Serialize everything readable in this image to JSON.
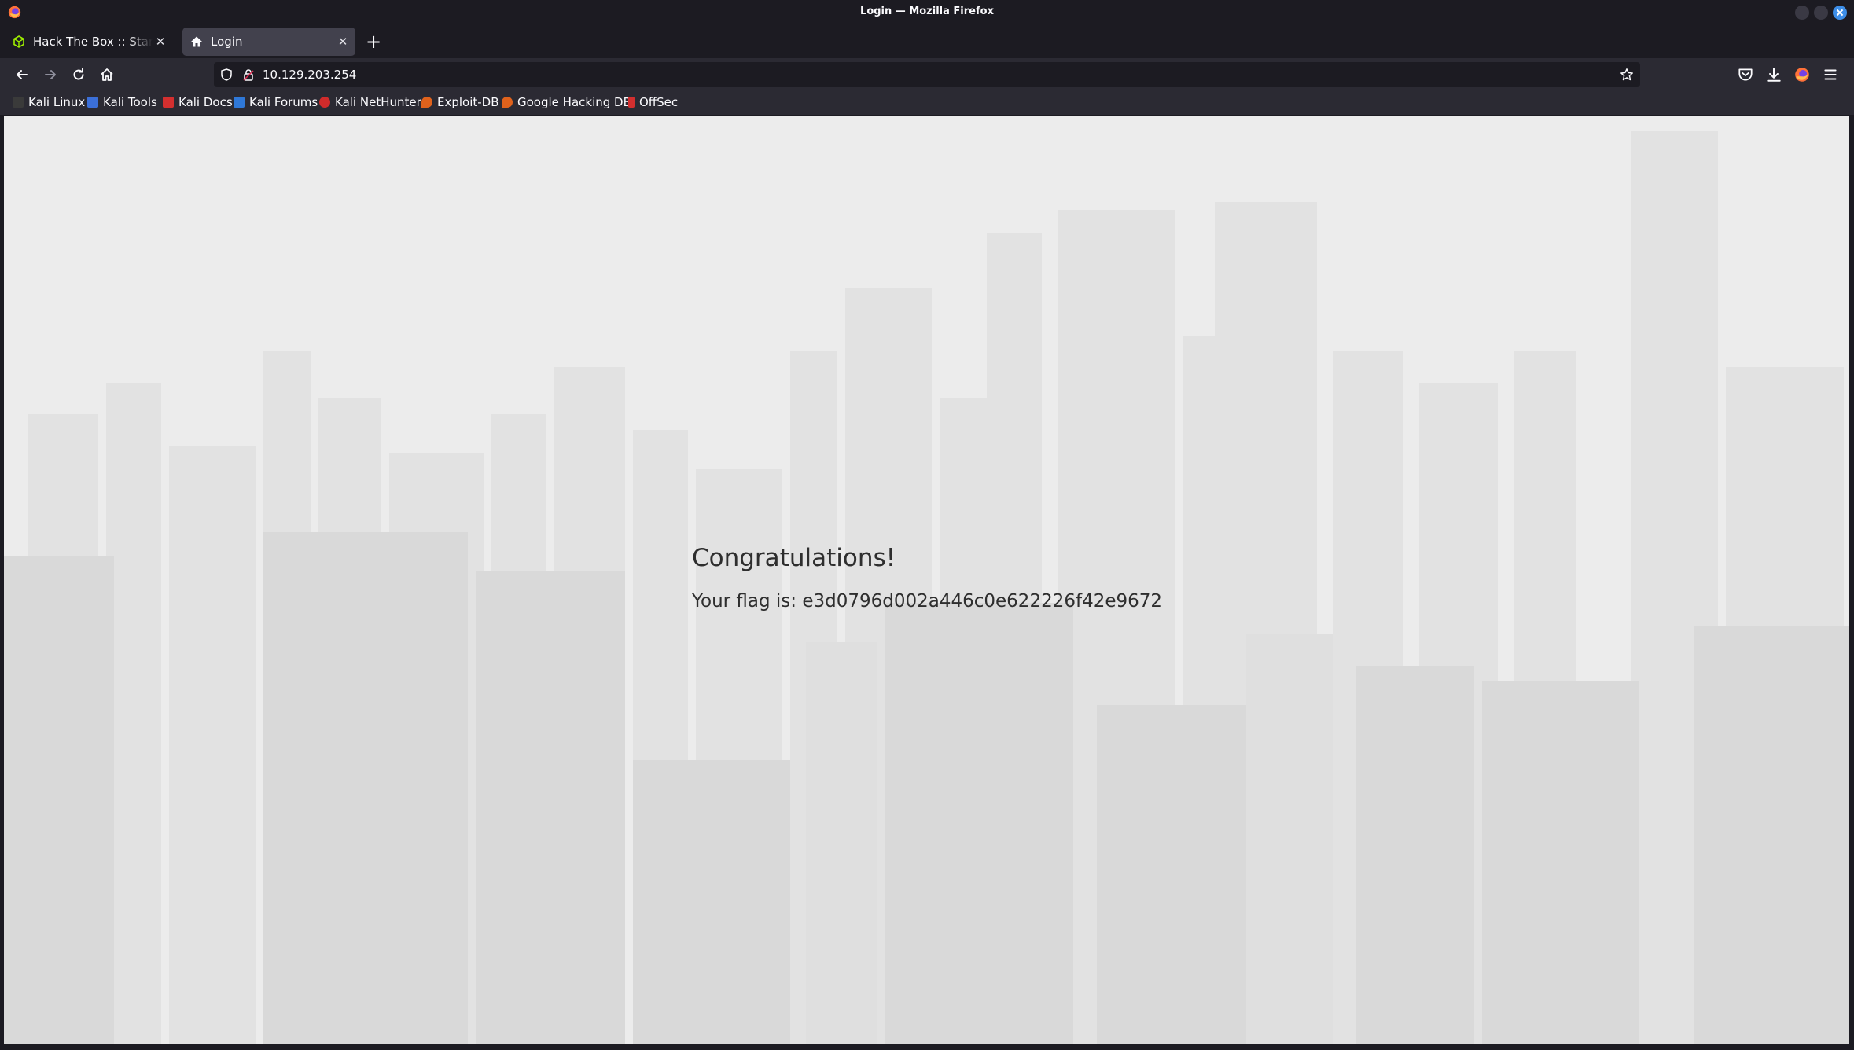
{
  "window": {
    "title": "Login — Mozilla Firefox"
  },
  "tabs": [
    {
      "label": "Hack The Box :: Starting P",
      "active": false,
      "favicon": "hackthebox-cube-icon"
    },
    {
      "label": "Login",
      "active": true,
      "favicon": "home-icon"
    }
  ],
  "navbar": {
    "url": "10.129.203.254"
  },
  "bookmarks": [
    {
      "label": "Kali Linux",
      "icon": "kali-dragon-icon",
      "color": "#3a3a3a"
    },
    {
      "label": "Kali Tools",
      "icon": "kali-tools-icon",
      "color": "#3b6fd8"
    },
    {
      "label": "Kali Docs",
      "icon": "kali-docs-icon",
      "color": "#d32f2f"
    },
    {
      "label": "Kali Forums",
      "icon": "kali-forums-icon",
      "color": "#2f78d8"
    },
    {
      "label": "Kali NetHunter",
      "icon": "nethunter-icon",
      "color": "#d12b2b"
    },
    {
      "label": "Exploit-DB",
      "icon": "exploit-db-icon",
      "color": "#e0621c"
    },
    {
      "label": "Google Hacking DB",
      "icon": "ghdb-icon",
      "color": "#e0621c"
    },
    {
      "label": "OffSec",
      "icon": "offsec-icon",
      "color": "#d32f2f"
    }
  ],
  "page": {
    "heading": "Congratulations!",
    "flag_text": "Your flag is: e3d0796d002a446c0e622226f42e9672"
  },
  "colors": {
    "chrome_dark": "#1c1b22",
    "toolbar": "#2b2a33",
    "active_tab": "#42414d",
    "page_background": "#ededed",
    "text": "#2e2e2e"
  }
}
